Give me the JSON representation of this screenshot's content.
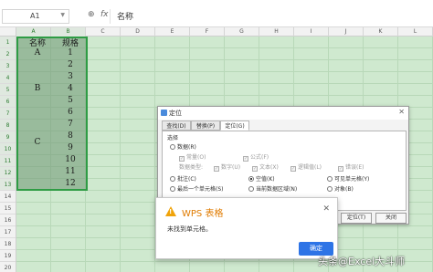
{
  "formula_bar": {
    "name_box": "A1",
    "zoom_icon": "zoom-icon",
    "fx_label": "fx",
    "content": "名称"
  },
  "sheet": {
    "columns": [
      "A",
      "B",
      "C",
      "D",
      "E",
      "F",
      "G",
      "H",
      "I",
      "J",
      "K",
      "L"
    ],
    "rows": [
      "1",
      "2",
      "3",
      "4",
      "5",
      "6",
      "7",
      "8",
      "9",
      "10",
      "11",
      "12",
      "13",
      "14",
      "15",
      "16",
      "17",
      "18",
      "19",
      "20"
    ],
    "header_a": "名称",
    "header_b": "规格",
    "col_a_values": [
      "A",
      "B",
      "C"
    ],
    "col_b_values": [
      "1",
      "2",
      "3",
      "4",
      "5",
      "6",
      "7",
      "8",
      "9",
      "10",
      "11",
      "12"
    ]
  },
  "locate_dialog": {
    "title": "定位",
    "tabs": [
      "查找(D)",
      "替换(P)",
      "定位(G)"
    ],
    "active_tab": "定位(G)",
    "group_label": "选择",
    "data_option": "数据(R)",
    "sub_options": [
      "常量(O)",
      "公式(F)"
    ],
    "type_label": "数据类型:",
    "type_options": [
      "数字(U)",
      "文本(X)",
      "逻辑值(L)",
      "错误(E)"
    ],
    "row2": [
      "批注(C)",
      "空值(K)",
      "可见单元格(Y)"
    ],
    "row3": [
      "最后一个单元格(S)",
      "当前数据区域(N)",
      "对象(B)"
    ],
    "selected_option": "空值(K)",
    "buttons": [
      "定位(T)",
      "关闭"
    ]
  },
  "message_box": {
    "title": "WPS 表格",
    "message": "未找到单元格。",
    "ok_label": "确定"
  },
  "watermark": {
    "text": "头条@Excel大斗师"
  },
  "colors": {
    "sheet_bg": "#cfe9cf",
    "selection_border": "#2e9c44",
    "dialog_title_accent": "#e07b00",
    "ok_button": "#2e74e6",
    "warning_icon": "#f0a30a"
  }
}
